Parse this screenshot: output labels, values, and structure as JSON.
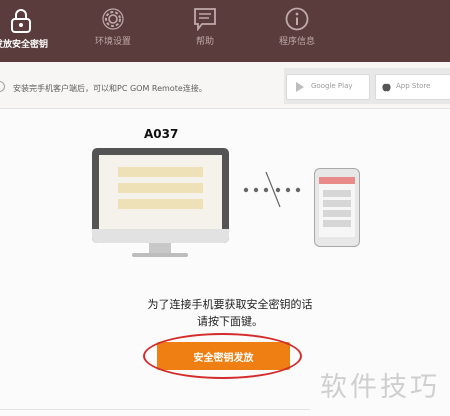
{
  "nav": {
    "tabs": [
      {
        "label": "发放安全密钥",
        "icon": "lock-icon",
        "active": true
      },
      {
        "label": "环境设置",
        "icon": "gear-icon",
        "active": false
      },
      {
        "label": "帮助",
        "icon": "chat-bubble-icon",
        "active": false
      },
      {
        "label": "程序信息",
        "icon": "info-icon",
        "active": false
      }
    ]
  },
  "infobar": {
    "text": "安装完手机客户端后，可以和PC GOM Remote连接。",
    "stores": [
      {
        "label": "Google Play",
        "icon": "play-store-icon"
      },
      {
        "label": "App Store",
        "icon": "apple-icon"
      }
    ]
  },
  "main": {
    "device_name": "A037",
    "message_line1": "为了连接手机要获取安全密钥的话",
    "message_line2": "请按下面键。",
    "issue_button": "安全密钥发放"
  },
  "watermark": "软件技巧",
  "colors": {
    "topbar": "#5b3c3c",
    "accent": "#ef7f13",
    "highlight": "#d42b2b"
  }
}
